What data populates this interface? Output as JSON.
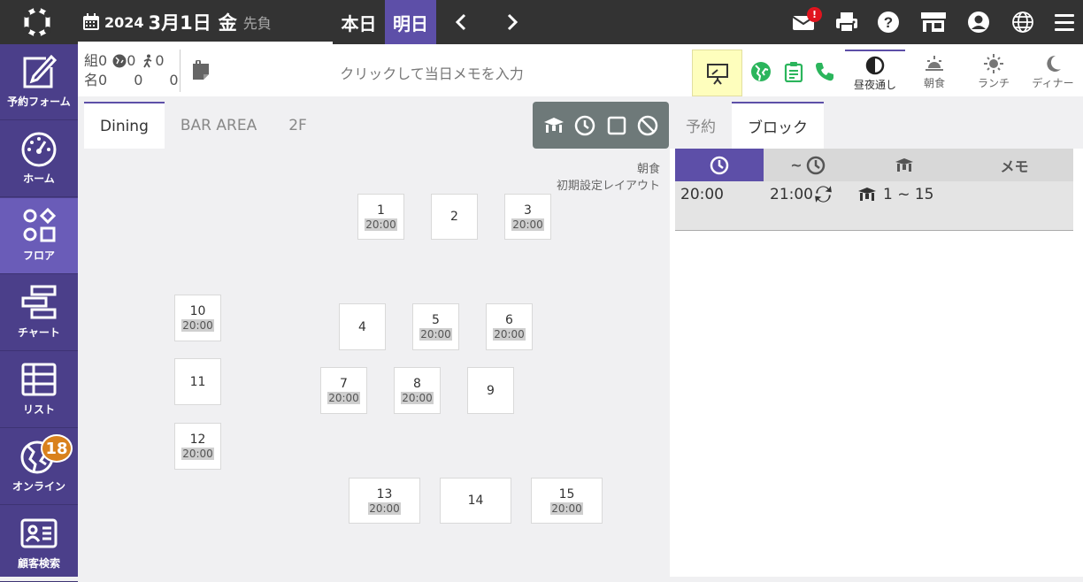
{
  "header": {
    "date_year": "2024",
    "date_md": "3月1日",
    "date_dow": "金",
    "date_rokuyo": "先負",
    "today_label": "本日",
    "tomorrow_label": "明日",
    "mail_badge": "!"
  },
  "sidebar": {
    "items": [
      {
        "label": "予約フォーム",
        "icon": "edit-form-icon"
      },
      {
        "label": "ホーム",
        "icon": "dashboard-gauge-icon"
      },
      {
        "label": "フロア",
        "icon": "floor-shapes-icon"
      },
      {
        "label": "チャート",
        "icon": "chart-bars-icon"
      },
      {
        "label": "リスト",
        "icon": "list-table-icon"
      },
      {
        "label": "オンライン",
        "icon": "online-globe-icon",
        "badge": "18"
      },
      {
        "label": "顧客検索",
        "icon": "customer-card-icon"
      }
    ],
    "active_index": 2
  },
  "infobar": {
    "groups_label": "組",
    "groups_total": "0",
    "groups_web": "0",
    "groups_walkin": "0",
    "people_label": "名",
    "people_total": "0",
    "people_web": "0",
    "people_walkin": "0",
    "memo_placeholder": "クリックして当日メモを入力",
    "meals": [
      {
        "label": "昼夜通し",
        "icon": "half-moon-icon"
      },
      {
        "label": "朝食",
        "icon": "sunrise-icon"
      },
      {
        "label": "ランチ",
        "icon": "sun-icon"
      },
      {
        "label": "ディナー",
        "icon": "moon-icon"
      }
    ],
    "active_meal": 0
  },
  "floor": {
    "tabs": [
      "Dining",
      "BAR AREA",
      "2F"
    ],
    "active_tab": 0,
    "layout_meal": "朝食",
    "layout_name": "初期設定レイアウト",
    "tables": [
      {
        "num": "1",
        "time": "20:00"
      },
      {
        "num": "2",
        "time": ""
      },
      {
        "num": "3",
        "time": "20:00"
      },
      {
        "num": "4",
        "time": ""
      },
      {
        "num": "5",
        "time": "20:00"
      },
      {
        "num": "6",
        "time": "20:00"
      },
      {
        "num": "7",
        "time": "20:00"
      },
      {
        "num": "8",
        "time": "20:00"
      },
      {
        "num": "9",
        "time": ""
      },
      {
        "num": "10",
        "time": "20:00"
      },
      {
        "num": "11",
        "time": ""
      },
      {
        "num": "12",
        "time": "20:00"
      },
      {
        "num": "13",
        "time": "20:00"
      },
      {
        "num": "14",
        "time": ""
      },
      {
        "num": "15",
        "time": "20:00"
      }
    ]
  },
  "panel": {
    "tabs": [
      "予約",
      "ブロック"
    ],
    "active_tab": 1,
    "head_to_label": "~",
    "head_memo_label": "メモ",
    "block": {
      "start": "20:00",
      "end": "21:00",
      "tables": "1 ~ 15"
    }
  },
  "colors": {
    "topbar": "#333333",
    "sidebar": "#4b3f8a",
    "sidebar_active": "#6a5cb8",
    "accent": "#5d4fa8",
    "green": "#2bb55c",
    "badge_orange": "#d9811c"
  }
}
